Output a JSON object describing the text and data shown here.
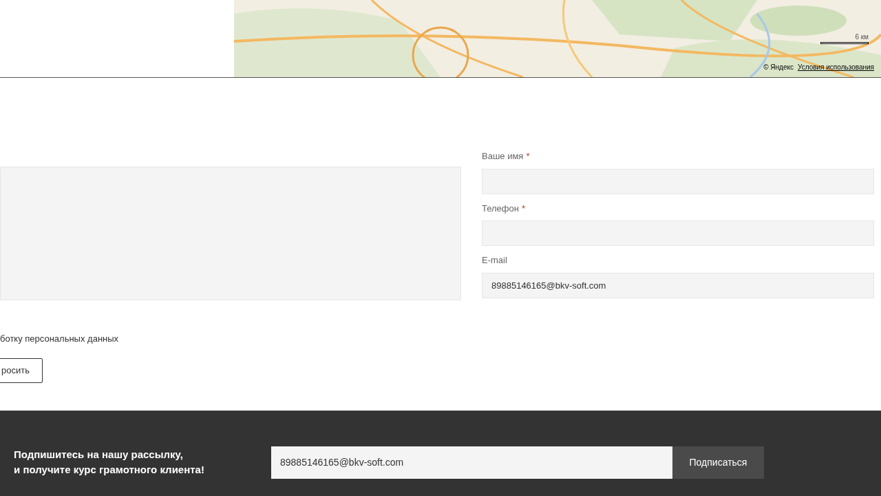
{
  "map": {
    "scale": "6 км",
    "attribution": "© Яндекс",
    "terms_link": "Условия использования"
  },
  "form": {
    "fields": [
      {
        "label": "Ваше имя",
        "required_mark": "*"
      },
      {
        "label": "Телефон",
        "required_mark": "*"
      },
      {
        "label": "E-mail",
        "value": "89885146165@bkv-soft.com"
      }
    ],
    "consent": "ботку персональных данных",
    "submit": "росить"
  },
  "footer": {
    "text": "Подпишитесь на нашу рассылку,\nи получите курс грамотного клиента!",
    "email": "89885146165@bkv-soft.com",
    "button": "Подписаться"
  }
}
